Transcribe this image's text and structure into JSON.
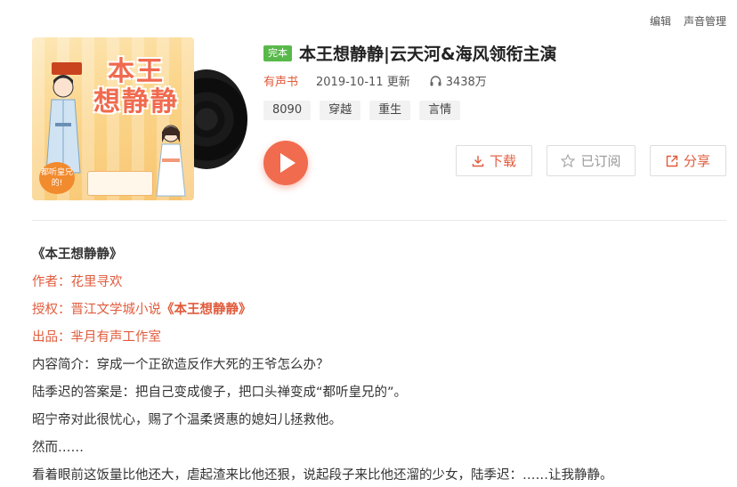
{
  "top_links": {
    "edit": "编辑",
    "voice_manage": "声音管理"
  },
  "album": {
    "status_badge": "完本",
    "title": "本王想静静|云天河&海风领衔主演",
    "type": "有声书",
    "updated": "2019-10-11 更新",
    "plays": "3438万",
    "tags": [
      "8090",
      "穿越",
      "重生",
      "言情"
    ]
  },
  "cover": {
    "title_line1": "本王",
    "title_line2": "想静静",
    "tagline": "都听皇兄的!"
  },
  "actions": {
    "download": "下载",
    "subscribed": "已订阅",
    "share": "分享"
  },
  "description": {
    "book_title": "《本王想静静》",
    "author_label": "作者：",
    "author": "花里寻欢",
    "license_prefix": "授权：晋江文学城小说",
    "license_book": "《本王想静静》",
    "producer_label": "出品：",
    "producer": "芈月有声工作室",
    "intro": "内容简介：穿成一个正欲造反作大死的王爷怎么办？",
    "line2": "陆季迟的答案是：把自己变成傻子，把口头禅变成“都听皇兄的”。",
    "line3": "昭宁帝对此很忧心，赐了个温柔贤惠的媳妇儿拯救他。",
    "line4": "然而……",
    "line5": "看着眼前这饭量比他还大，虐起渣来比他还狠，说起段子来比他还溜的少女，陆季迟：……让我静静。"
  },
  "colors": {
    "accent": "#e05b3c",
    "badge": "#58b94a",
    "play": "#f16b4e"
  }
}
